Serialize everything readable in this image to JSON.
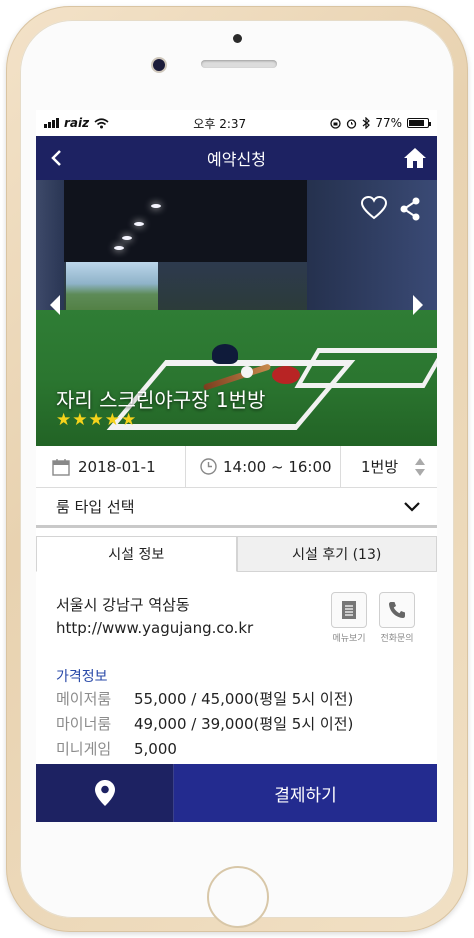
{
  "status_bar": {
    "carrier": "raiz",
    "time": "오후 2:37",
    "battery": "77%"
  },
  "header": {
    "title": "예약신청"
  },
  "hero": {
    "title": "자리 스크린야구장 1번방",
    "rating_stars": "★★★★★"
  },
  "booking": {
    "date": "2018-01-1",
    "time": "14:00 ~ 16:00",
    "room": "1번방"
  },
  "room_type": {
    "label": "룸 타입 선택"
  },
  "tabs": [
    {
      "label": "시설 정보"
    },
    {
      "label": "시설 후기 (13)"
    }
  ],
  "facility": {
    "address": "서울시 강남구 역삼동",
    "website": "http://www.yagujang.co.kr",
    "menu_label": "메뉴보기",
    "call_label": "전화문의"
  },
  "pricing": {
    "heading": "가격정보",
    "rows": [
      {
        "label": "메이저룸",
        "value": "55,000 / 45,000(평일 5시 이전)"
      },
      {
        "label": "마이너룸",
        "value": "49,000 / 39,000(평일 5시 이전)"
      },
      {
        "label": "미니게임",
        "value": "5,000"
      }
    ]
  },
  "bottom": {
    "pay_label": "결제하기"
  },
  "colors": {
    "navy": "#1d2262",
    "pay_blue": "#232b8f",
    "star": "#f5d31b",
    "link_blue": "#2a4aa8"
  }
}
